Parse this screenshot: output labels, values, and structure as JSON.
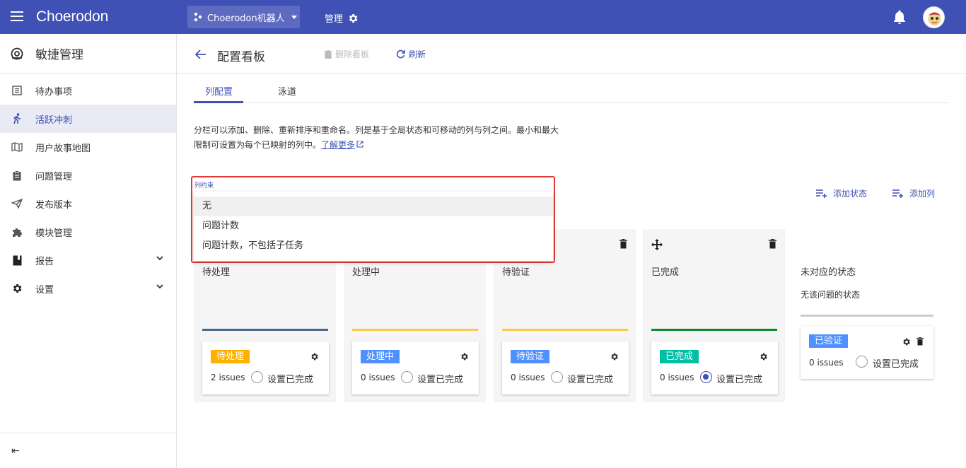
{
  "app": {
    "logo": "Choerodon"
  },
  "topbar": {
    "project": "Choerodon机器人",
    "manage": "管理"
  },
  "sidebar": {
    "title": "敏捷管理",
    "items": [
      {
        "label": "待办事项",
        "icon": "list-icon"
      },
      {
        "label": "活跃冲刺",
        "icon": "run-icon",
        "active": true
      },
      {
        "label": "用户故事地图",
        "icon": "map-icon"
      },
      {
        "label": "问题管理",
        "icon": "clipboard-icon"
      },
      {
        "label": "发布版本",
        "icon": "send-icon"
      },
      {
        "label": "模块管理",
        "icon": "puzzle-icon"
      },
      {
        "label": "报告",
        "icon": "book-icon"
      },
      {
        "label": "设置",
        "icon": "gear-icon"
      }
    ],
    "collapse": "⇤"
  },
  "page": {
    "title": "配置看板",
    "delete_board": "删除看板",
    "refresh": "刷新",
    "tabs": [
      "列配置",
      "泳道"
    ],
    "desc": "分栏可以添加、删除、重新排序和重命名。列是基于全局状态和可移动的列与列之间。最小和最大限制可设置为每个已映射的列中。",
    "learn_more": "了解更多",
    "add_status": "添加状态",
    "add_column": "添加列"
  },
  "dropdown": {
    "label": "列约束",
    "options": [
      "无",
      "问题计数",
      "问题计数，不包括子任务"
    ],
    "selected": "无"
  },
  "columns": [
    {
      "name": "待处理",
      "bar_color": "#4d6a8e",
      "status": "待处理",
      "status_color": "#ffb100",
      "issues": "2 issues",
      "done_label": "设置已完成",
      "done": false
    },
    {
      "name": "处理中",
      "bar_color": "#f8c94a",
      "status": "处理中",
      "status_color": "#4d90fe",
      "issues": "0 issues",
      "done_label": "设置已完成",
      "done": false
    },
    {
      "name": "待验证",
      "bar_color": "#f8c94a",
      "status": "待验证",
      "status_color": "#4d90fe",
      "issues": "0 issues",
      "done_label": "设置已完成",
      "done": false
    },
    {
      "name": "已完成",
      "bar_color": "#118833",
      "status": "已完成",
      "status_color": "#00bfa5",
      "issues": "0 issues",
      "done_label": "设置已完成",
      "done": true
    }
  ],
  "unmapped": {
    "title": "未对应的状态",
    "subtitle": "无该问题的状态",
    "card": {
      "status": "已验证",
      "status_color": "#4d90fe",
      "issues": "0 issues",
      "done_label": "设置已完成",
      "done": false
    }
  }
}
